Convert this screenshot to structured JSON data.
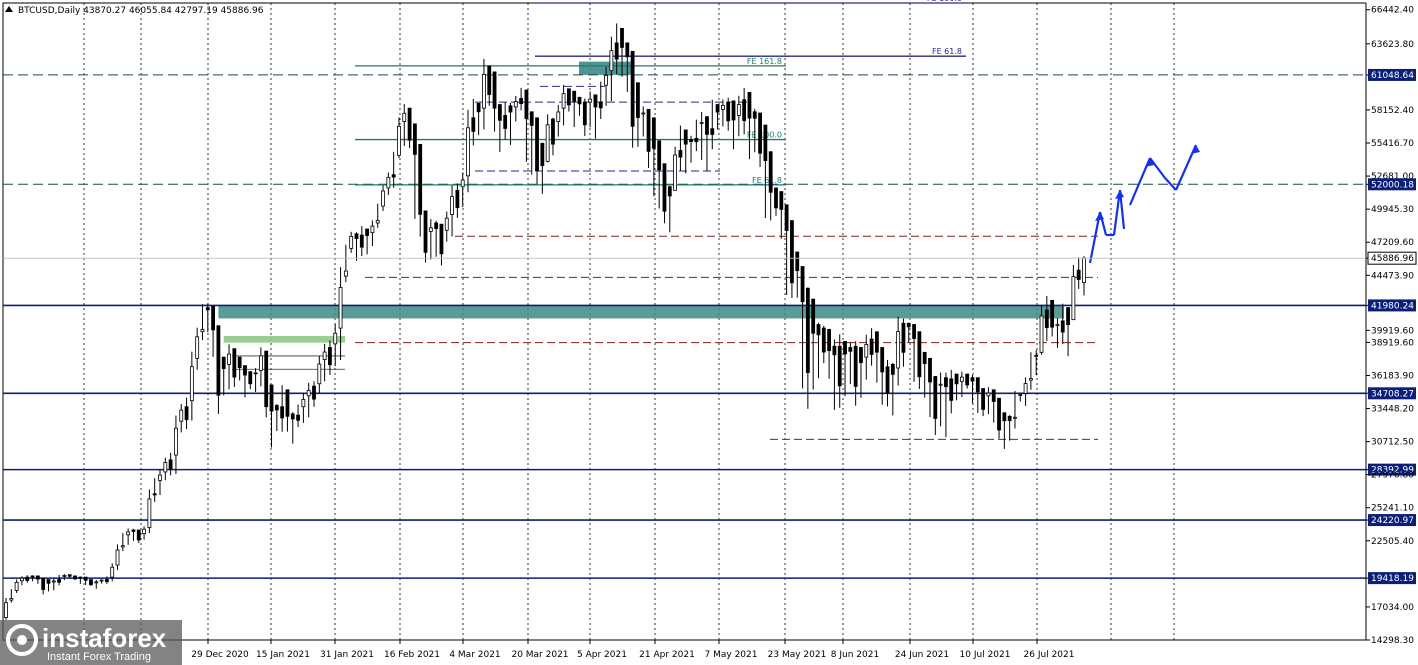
{
  "header": {
    "symbol_info": "BTCUSD,Daily  43870.27 46055.84 42797.19 45886.96"
  },
  "watermark": {
    "brand": "instaforex",
    "tagline": "Instant Forex Trading"
  },
  "colors": {
    "candle": "#000000",
    "level_line": "#0b1f7a",
    "dashed_level": "#1d4a48",
    "zone_teal": "#3d8a86",
    "zone_green": "#8fc986",
    "fib_line": "#1d7a6f",
    "fe_upper": "#2a2a82",
    "red_dashed": "#8b1a1a",
    "projection_arrow": "#1532e8",
    "current_price_box": "#ffffff",
    "level_label_box": "#0b1f7a"
  },
  "chart_data": {
    "type": "candlestick",
    "symbol": "BTCUSD",
    "timeframe": "Daily",
    "last_bar": {
      "open": 43870.27,
      "high": 46055.84,
      "low": 42797.19,
      "close": 45886.96
    },
    "y_axis": {
      "range": [
        14298.0,
        67000.0
      ],
      "ticks": [
        "66442.40",
        "63623.80",
        "61048.64",
        "58152.40",
        "55416.70",
        "52681.00",
        "52000.18",
        "49945.30",
        "47209.60",
        "45886.96",
        "44473.90",
        "41980.24",
        "39919.60",
        "38919.60",
        "36183.90",
        "34708.27",
        "33448.20",
        "30712.50",
        "28392.99",
        "27976.80",
        "25241.10",
        "24220.97",
        "22505.40",
        "19418.19",
        "17034.00",
        "14298.30"
      ]
    },
    "x_axis": {
      "ticks": [
        "29 Dec 2020",
        "15 Jan 2021",
        "31 Jan 2021",
        "16 Feb 2021",
        "4 Mar 2021",
        "20 Mar 2021",
        "5 Apr 2021",
        "21 Apr 2021",
        "7 May 2021",
        "23 May 2021",
        "8 Jun 2021",
        "24 Jun 2021",
        "10 Jul 2021",
        "26 Jul 2021"
      ]
    },
    "horizontal_levels": [
      {
        "price": 61048.64,
        "style": "dashed"
      },
      {
        "price": 52000.18,
        "style": "dashed"
      },
      {
        "price": 41980.24,
        "style": "solid"
      },
      {
        "price": 34708.27,
        "style": "solid"
      },
      {
        "price": 28392.99,
        "style": "solid"
      },
      {
        "price": 24220.97,
        "style": "solid"
      },
      {
        "price": 19418.19,
        "style": "solid"
      }
    ],
    "fib_labels": [
      {
        "text": "FE 161.8",
        "price": 61800
      },
      {
        "text": "FE 100.0",
        "price": 55700
      },
      {
        "text": "FE 61.8",
        "price": 51950
      },
      {
        "text": "FE 61.8",
        "price": 62600
      },
      {
        "text": "FE 100.0",
        "price": 67000
      }
    ],
    "red_dashed_levels": [
      47700,
      44300,
      38900,
      30900
    ],
    "current_price": 45886.96,
    "projection_path": [
      [
        1090,
        263
      ],
      [
        1100,
        212
      ],
      [
        1106,
        235
      ],
      [
        1114,
        235
      ],
      [
        1120,
        190
      ],
      [
        1124,
        229
      ],
      [
        1130,
        205
      ],
      [
        1150,
        158
      ],
      [
        1165,
        178
      ],
      [
        1176,
        190
      ],
      [
        1196,
        145
      ]
    ],
    "candles": [
      [
        16150,
        17600
      ],
      [
        17500,
        18400
      ],
      [
        18300,
        19200
      ],
      [
        18900,
        19500
      ],
      [
        19100,
        19600
      ],
      [
        19200,
        19600
      ],
      [
        19000,
        19400
      ],
      [
        18200,
        19300
      ],
      [
        18400,
        19100
      ],
      [
        18500,
        19300
      ],
      [
        18900,
        19600
      ],
      [
        19300,
        19700
      ],
      [
        19400,
        19600
      ],
      [
        19300,
        19500
      ],
      [
        19000,
        19500
      ],
      [
        18900,
        19300
      ],
      [
        18800,
        19100
      ],
      [
        18600,
        19200
      ],
      [
        19000,
        19300
      ],
      [
        19000,
        19500
      ],
      [
        19300,
        20500
      ],
      [
        20300,
        22000
      ],
      [
        21800,
        23000
      ],
      [
        22300,
        23400
      ],
      [
        22600,
        23400
      ],
      [
        22400,
        23100
      ],
      [
        22700,
        23600
      ],
      [
        23500,
        26400
      ],
      [
        25900,
        27500
      ],
      [
        26500,
        28200
      ],
      [
        27700,
        29200
      ],
      [
        28100,
        29600
      ],
      [
        28500,
        32400
      ],
      [
        31700,
        33600
      ],
      [
        32000,
        34100
      ],
      [
        33000,
        37600
      ],
      [
        37000,
        39800
      ],
      [
        39400,
        41800
      ],
      [
        40000,
        41900
      ],
      [
        38000,
        40300
      ],
      [
        33500,
        37700
      ],
      [
        34800,
        37100
      ],
      [
        35400,
        38400
      ],
      [
        35500,
        37700
      ],
      [
        35900,
        37000
      ],
      [
        34600,
        36500
      ],
      [
        35200,
        36400
      ],
      [
        35000,
        36600
      ],
      [
        35600,
        38200
      ],
      [
        33000,
        35400
      ],
      [
        30600,
        33700
      ],
      [
        31800,
        33600
      ],
      [
        31900,
        35000
      ],
      [
        31700,
        33000
      ],
      [
        30800,
        32900
      ],
      [
        32100,
        33600
      ],
      [
        32500,
        34500
      ],
      [
        33000,
        35300
      ],
      [
        33800,
        35500
      ],
      [
        35000,
        37500
      ],
      [
        36000,
        38500
      ],
      [
        36500,
        38800
      ],
      [
        37300,
        40100
      ],
      [
        38200,
        44400
      ],
      [
        44200,
        46700
      ],
      [
        46500,
        47900
      ],
      [
        45900,
        47800
      ],
      [
        46300,
        48300
      ],
      [
        46400,
        48000
      ],
      [
        47100,
        48800
      ],
      [
        48600,
        50200
      ],
      [
        50000,
        51700
      ],
      [
        51300,
        52800
      ],
      [
        52000,
        54400
      ],
      [
        54500,
        57200
      ],
      [
        55500,
        58300
      ],
      [
        55200,
        57000
      ],
      [
        49800,
        55300
      ],
      [
        47900,
        49800
      ],
      [
        45800,
        48100
      ],
      [
        46100,
        48800
      ],
      [
        46300,
        48700
      ],
      [
        45600,
        48200
      ],
      [
        47500,
        49500
      ],
      [
        48100,
        51500
      ],
      [
        49500,
        51800
      ],
      [
        50400,
        52700
      ],
      [
        52000,
        57500
      ],
      [
        55600,
        58700
      ],
      [
        56300,
        58300
      ],
      [
        57100,
        61800
      ],
      [
        58800,
        61300
      ],
      [
        56600,
        58600
      ],
      [
        55000,
        57700
      ],
      [
        56000,
        58500
      ],
      [
        55600,
        58400
      ],
      [
        57400,
        59100
      ],
      [
        58300,
        59800
      ],
      [
        54300,
        58000
      ],
      [
        53300,
        57500
      ],
      [
        52400,
        55400
      ],
      [
        51500,
        53900
      ],
      [
        54200,
        57400
      ],
      [
        54700,
        57200
      ],
      [
        56200,
        58300
      ],
      [
        57200,
        59900
      ],
      [
        58200,
        59700
      ],
      [
        57000,
        59200
      ],
      [
        57800,
        58800
      ],
      [
        56300,
        58800
      ],
      [
        57000,
        59400
      ],
      [
        56100,
        58800
      ],
      [
        57700,
        60200
      ],
      [
        58800,
        61400
      ],
      [
        59400,
        63700
      ],
      [
        61500,
        64900
      ],
      [
        61200,
        63700
      ],
      [
        60000,
        63000
      ],
      [
        55600,
        60400
      ],
      [
        55400,
        57900
      ],
      [
        56200,
        58200
      ],
      [
        53800,
        57500
      ],
      [
        51500,
        55600
      ],
      [
        50400,
        53700
      ],
      [
        49100,
        51800
      ],
      [
        48400,
        51500
      ],
      [
        52300,
        54800
      ],
      [
        53500,
        56500
      ],
      [
        53200,
        55700
      ],
      [
        54000,
        55800
      ],
      [
        55000,
        57100
      ],
      [
        54400,
        57600
      ],
      [
        53500,
        56600
      ],
      [
        55300,
        58600
      ],
      [
        56700,
        58200
      ],
      [
        57000,
        58800
      ],
      [
        56700,
        58900
      ],
      [
        55200,
        57700
      ],
      [
        56300,
        59000
      ],
      [
        56500,
        59600
      ],
      [
        54500,
        58000
      ],
      [
        55000,
        57900
      ],
      [
        53800,
        56900
      ],
      [
        49800,
        54700
      ],
      [
        49300,
        51700
      ],
      [
        49600,
        51400
      ],
      [
        47800,
        50300
      ],
      [
        43500,
        49000
      ],
      [
        43000,
        46400
      ],
      [
        42900,
        45200
      ],
      [
        36000,
        43400
      ],
      [
        34400,
        42500
      ],
      [
        35600,
        40400
      ],
      [
        36400,
        40100
      ],
      [
        37500,
        40000
      ],
      [
        36200,
        38600
      ],
      [
        33900,
        38600
      ],
      [
        34100,
        39000
      ],
      [
        34900,
        38500
      ],
      [
        35800,
        38600
      ],
      [
        34200,
        38500
      ],
      [
        34700,
        37700
      ],
      [
        36200,
        39200
      ],
      [
        37300,
        39800
      ],
      [
        35900,
        38500
      ],
      [
        34100,
        36900
      ],
      [
        34000,
        37100
      ],
      [
        33300,
        36800
      ],
      [
        35900,
        40500
      ],
      [
        37300,
        40500
      ],
      [
        39100,
        40400
      ],
      [
        36100,
        39800
      ],
      [
        35400,
        38100
      ],
      [
        34700,
        37600
      ],
      [
        33100,
        36100
      ],
      [
        31700,
        35400
      ],
      [
        32400,
        36000
      ],
      [
        31600,
        35900
      ],
      [
        33400,
        36300
      ],
      [
        34300,
        35700
      ],
      [
        34600,
        36300
      ],
      [
        35200,
        36000
      ],
      [
        34100,
        36000
      ],
      [
        33300,
        35100
      ],
      [
        33000,
        34500
      ],
      [
        33200,
        35000
      ],
      [
        32500,
        34300
      ],
      [
        31200,
        33100
      ],
      [
        30400,
        32800
      ],
      [
        31000,
        32700
      ],
      [
        32100,
        34600
      ],
      [
        34100,
        34700
      ],
      [
        33900,
        35800
      ],
      [
        35300,
        37800
      ],
      [
        36400,
        38100
      ],
      [
        38300,
        41600
      ],
      [
        39400,
        42400
      ],
      [
        39500,
        40300
      ],
      [
        38700,
        40700
      ],
      [
        39100,
        41800
      ],
      [
        38100,
        40800
      ],
      [
        41300,
        44900
      ],
      [
        43600,
        45700
      ],
      [
        43870,
        46056
      ]
    ]
  }
}
